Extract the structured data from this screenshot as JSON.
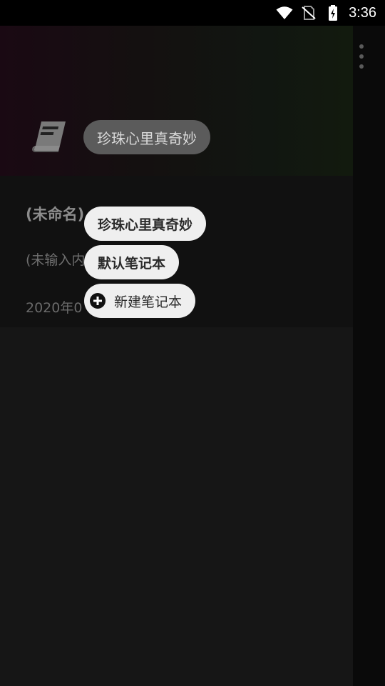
{
  "status_bar": {
    "time": "3:36"
  },
  "header": {
    "notebook_chip": "珍珠心里真奇妙"
  },
  "note": {
    "title": "(未命名)",
    "preview": "(未输入内",
    "date": "2020年0"
  },
  "popup": {
    "items": [
      {
        "label": "珍珠心里真奇妙"
      },
      {
        "label": "默认笔记本"
      }
    ],
    "new_notebook_label": "新建笔记本"
  }
}
